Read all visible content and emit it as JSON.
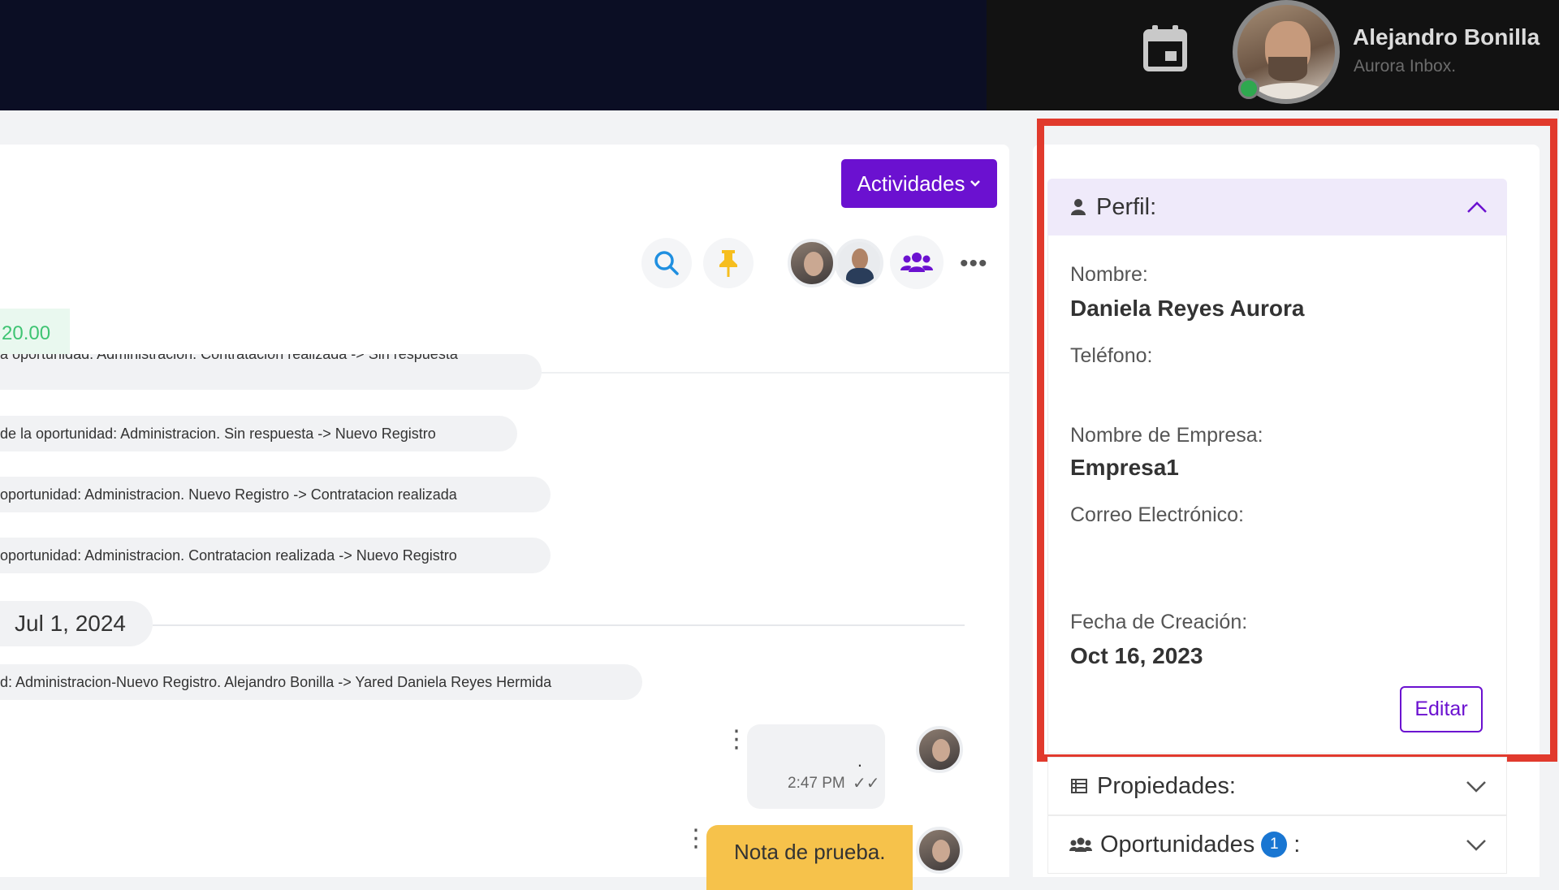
{
  "header": {
    "user_name": "Alejandro Bonilla",
    "user_subtitle": "Aurora Inbox."
  },
  "toolbar": {
    "activities_label": "Actividades"
  },
  "deal_amount": "20.00",
  "activity_log": [
    "a oportunidad: Administracion. Contratacion realizada -> Sin respuesta",
    "de la oportunidad: Administracion. Sin respuesta -> Nuevo Registro",
    " oportunidad: Administracion. Nuevo Registro -> Contratacion realizada",
    " oportunidad: Administracion. Contratacion realizada -> Nuevo Registro"
  ],
  "date_separator": "Jul 1, 2024",
  "assignment_log": "d: Administracion-Nuevo Registro. Alejandro Bonilla -> Yared Daniela Reyes Hermida",
  "messages": {
    "msg1_text": ".",
    "msg1_time": "2:47 PM",
    "msg1_ticks": "✓✓",
    "note_text": "Nota de prueba."
  },
  "profile": {
    "title": "Perfil:",
    "name_label": "Nombre:",
    "name_value": "Daniela Reyes Aurora",
    "phone_label": "Teléfono:",
    "phone_value": "",
    "company_label": "Nombre de Empresa:",
    "company_value": "Empresa1",
    "email_label": "Correo Electrónico:",
    "created_label": "Fecha de Creación:",
    "created_value": "Oct 16, 2023",
    "edit_label": "Editar"
  },
  "sections": {
    "properties_label": "Propiedades:",
    "opportunities_label": "Oportunidades",
    "opportunities_count": "1",
    "opportunities_colon": ":"
  },
  "colors": {
    "primary": "#6b11d0",
    "highlight": "#e13a2d",
    "note": "#f6c24b",
    "badge": "#1976d2"
  }
}
